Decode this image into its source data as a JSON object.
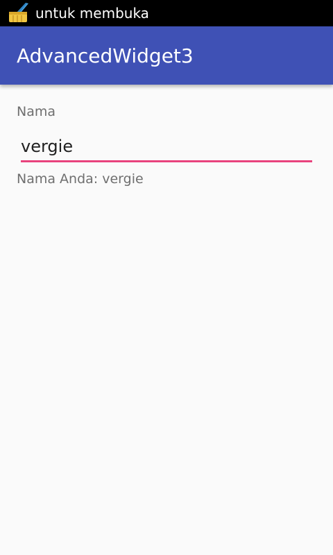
{
  "status_bar": {
    "notification_text": "untuk membuka",
    "icon": "broom-icon"
  },
  "app_bar": {
    "title": "AdvancedWidget3",
    "color": "#3f51b5"
  },
  "form": {
    "name_label": "Nama",
    "name_value": "vergie",
    "result_text": "Nama Anda: vergie",
    "accent_color": "#e8437d"
  }
}
